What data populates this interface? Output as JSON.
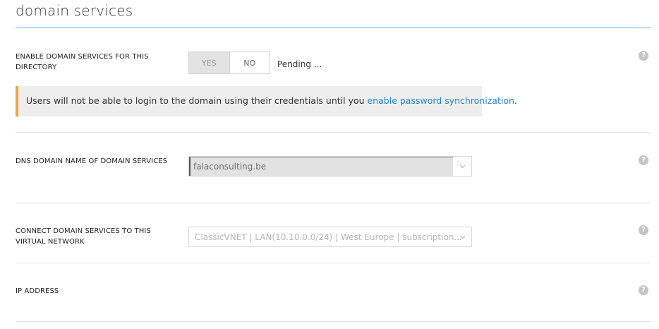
{
  "page": {
    "title": "domain services"
  },
  "enable_section": {
    "label": "ENABLE DOMAIN SERVICES FOR THIS DIRECTORY",
    "toggle": {
      "yes_label": "YES",
      "no_label": "NO",
      "selected": "YES"
    },
    "status": "Pending ...",
    "help_icon": "question-circle-icon"
  },
  "warning": {
    "text_before": "Users will not be able to login to the domain using their credentials until you ",
    "link_text": "enable password synchronization",
    "text_after": ".",
    "accent_color": "#f0a63a",
    "link_color": "#1f86c8"
  },
  "dns_section": {
    "label": "DNS DOMAIN NAME OF DOMAIN SERVICES",
    "value": "falaconsulting.be",
    "help_icon": "question-circle-icon"
  },
  "vnet_section": {
    "label": "CONNECT DOMAIN SERVICES TO THIS VIRTUAL NETWORK",
    "value": "ClassicVNET | LAN(10.10.0.0/24) | West Europe | subscription...",
    "help_icon": "question-circle-icon"
  },
  "ip_section": {
    "label": "IP ADDRESS",
    "help_icon": "question-circle-icon"
  },
  "help_glyph": "?"
}
